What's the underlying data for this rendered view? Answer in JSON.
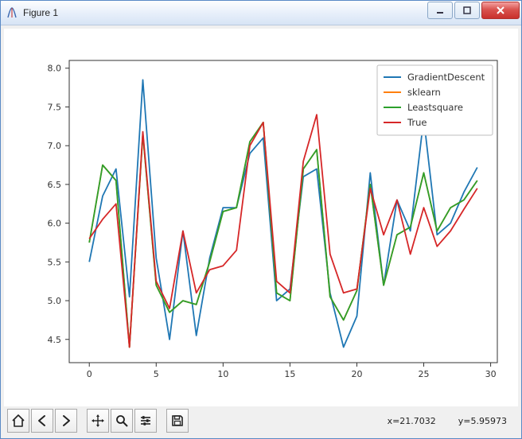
{
  "window": {
    "title": "Figure 1"
  },
  "toolbar": {
    "coord_x_label": "x=21.7032",
    "coord_y_label": "y=5.95973"
  },
  "chart_data": {
    "type": "line",
    "x": [
      0,
      1,
      2,
      3,
      4,
      5,
      6,
      7,
      8,
      9,
      10,
      11,
      12,
      13,
      14,
      15,
      16,
      17,
      18,
      19,
      20,
      21,
      22,
      23,
      24,
      25,
      26,
      27,
      28,
      29
    ],
    "series": [
      {
        "name": "GradientDescent",
        "color": "#1f77b4",
        "values": [
          5.5,
          6.35,
          6.7,
          5.05,
          7.85,
          5.55,
          4.5,
          5.9,
          4.55,
          5.55,
          6.2,
          6.2,
          6.9,
          7.1,
          5.0,
          5.15,
          6.6,
          6.7,
          5.1,
          4.4,
          4.8,
          6.65,
          5.2,
          6.3,
          5.9,
          7.35,
          5.85,
          6.0,
          6.4,
          6.72
        ]
      },
      {
        "name": "sklearn",
        "color": "#ff7f0e",
        "values": [
          5.75,
          6.75,
          6.55,
          4.4,
          7.15,
          5.2,
          4.85,
          5.0,
          4.95,
          5.5,
          6.15,
          6.2,
          7.05,
          7.3,
          5.1,
          5.0,
          6.7,
          6.95,
          5.05,
          4.75,
          5.13,
          6.5,
          5.2,
          5.85,
          5.95,
          6.65,
          5.9,
          6.2,
          6.3,
          6.55
        ]
      },
      {
        "name": "Leastsquare",
        "color": "#2ca02c",
        "values": [
          5.75,
          6.75,
          6.55,
          4.4,
          7.15,
          5.2,
          4.85,
          5.0,
          4.95,
          5.5,
          6.15,
          6.2,
          7.05,
          7.3,
          5.1,
          5.0,
          6.7,
          6.95,
          5.05,
          4.75,
          5.13,
          6.5,
          5.2,
          5.85,
          5.95,
          6.65,
          5.9,
          6.2,
          6.3,
          6.55
        ]
      },
      {
        "name": "True",
        "color": "#d62728",
        "values": [
          5.8,
          6.05,
          6.25,
          4.4,
          7.18,
          5.25,
          4.9,
          5.9,
          5.1,
          5.4,
          5.45,
          5.65,
          7.0,
          7.3,
          5.25,
          5.1,
          6.8,
          7.4,
          5.6,
          5.1,
          5.15,
          6.45,
          5.85,
          6.3,
          5.6,
          6.2,
          5.7,
          5.9,
          6.18,
          6.45
        ]
      }
    ],
    "legend_labels": [
      "GradientDescent",
      "sklearn",
      "Leastsquare",
      "True"
    ],
    "xlim": [
      -1.5,
      30.5
    ],
    "ylim": [
      4.2,
      8.1
    ],
    "xticks": [
      0,
      5,
      10,
      15,
      20,
      25,
      30
    ],
    "yticks": [
      4.5,
      5.0,
      5.5,
      6.0,
      6.5,
      7.0,
      7.5,
      8.0
    ],
    "title": "",
    "xlabel": "",
    "ylabel": ""
  }
}
